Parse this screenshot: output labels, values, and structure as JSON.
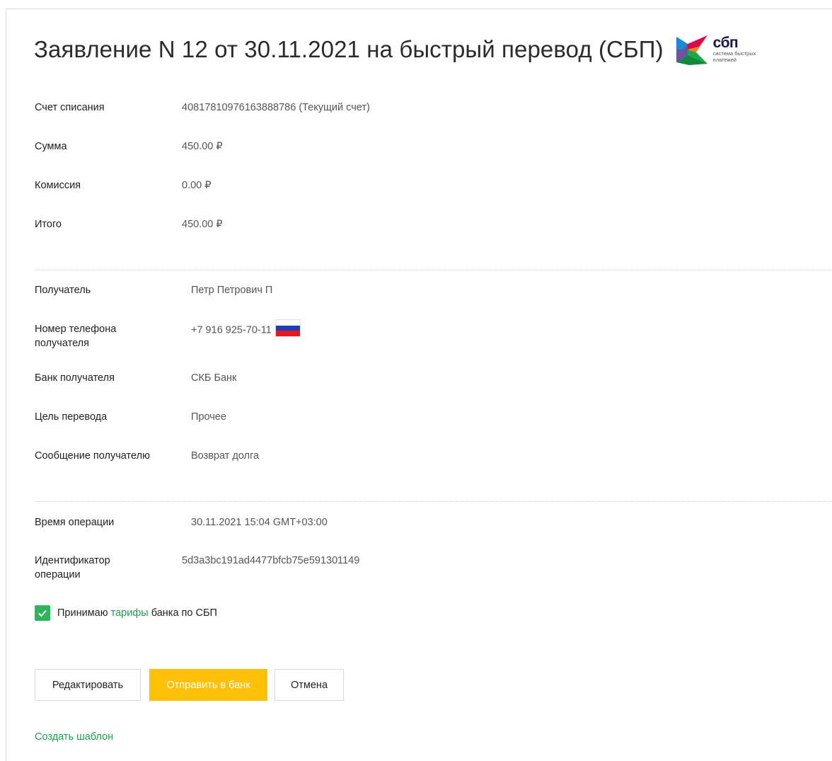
{
  "title": "Заявление N 12 от 30.11.2021 на быстрый перевод (СБП)",
  "logo": {
    "name": "сбп",
    "subtitle": "система быстрых платежей"
  },
  "colors": {
    "accent_green": "#2fb45b",
    "link_green": "#20a050",
    "primary_button": "#ffc107",
    "sbp_dark": "#1d1346"
  },
  "details": [
    {
      "label": "Счет списания",
      "value": "40817810976163888786 (Текущий счет)"
    },
    {
      "label": "Сумма",
      "value": "450.00 ₽"
    },
    {
      "label": "Комиссия",
      "value": "0.00 ₽"
    },
    {
      "label": "Итого",
      "value": "450.00 ₽"
    },
    {
      "label": "Получатель",
      "value": "Петр Петрович П"
    },
    {
      "label": "Номер телефона получателя",
      "value": "+7 916 925-70-11",
      "icon": "russia-flag-icon"
    },
    {
      "label": "Банк получателя",
      "value": "СКБ Банк"
    },
    {
      "label": "Цель перевода",
      "value": "Прочее"
    },
    {
      "label": "Сообщение получателю",
      "value": "Возврат долга"
    },
    {
      "label": "Время операции",
      "value": "30.11.2021 15:04 GMT+03:00"
    },
    {
      "label": "Идентификатор операции",
      "value": "5d3a3bc191ad4477bfcb75e591301149"
    }
  ],
  "agreement": {
    "checked": true,
    "prefix": "Принимаю",
    "link": "тарифы",
    "suffix": "банка по СБП"
  },
  "buttons": {
    "edit": "Редактировать",
    "send": "Отправить в банк",
    "cancel": "Отмена"
  },
  "create_template": "Создать шаблон"
}
